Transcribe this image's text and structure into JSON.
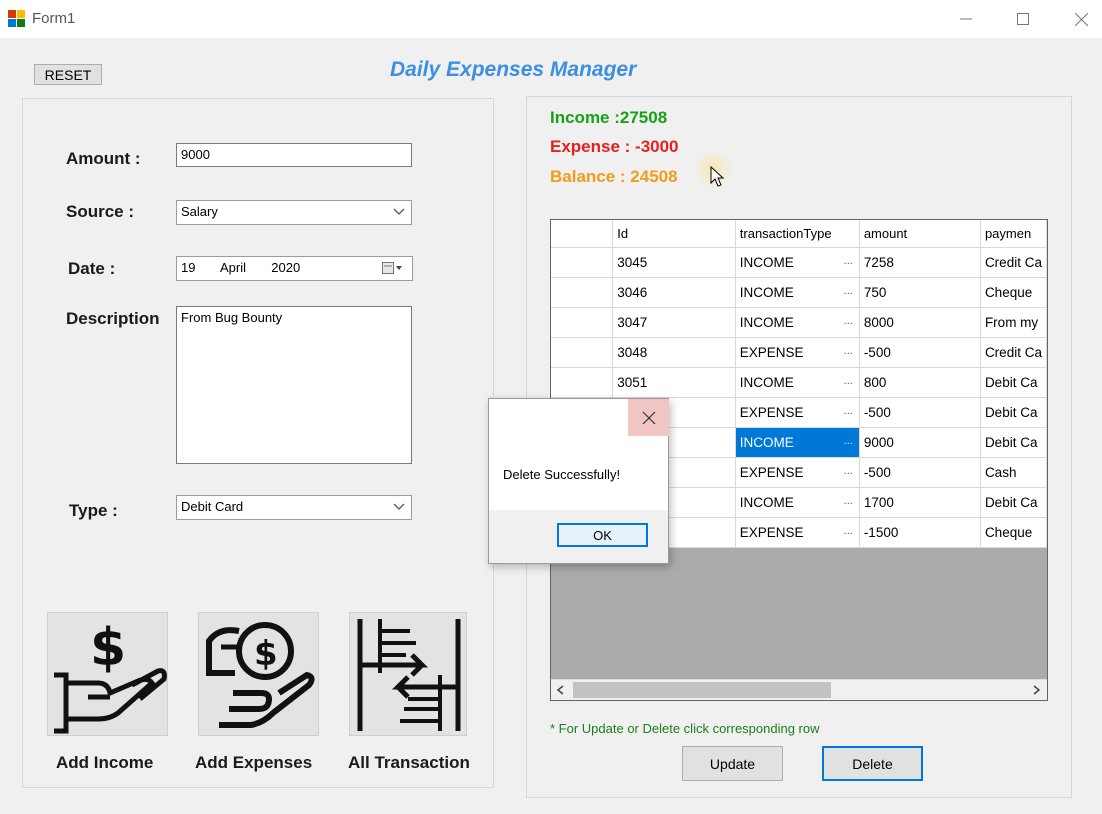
{
  "window": {
    "title": "Form1"
  },
  "toolbar": {
    "reset_label": "RESET"
  },
  "app_title": "Daily Expenses Manager",
  "form": {
    "amount_label": "Amount :",
    "amount_value": "9000",
    "source_label": "Source :",
    "source_value": "Salary",
    "date_label": "Date :",
    "date_day": "19",
    "date_month": "April",
    "date_year": "2020",
    "description_label": "Description",
    "description_value": "From Bug Bounty",
    "type_label": "Type :",
    "type_value": "Debit Card"
  },
  "actions": {
    "add_income": "Add Income",
    "add_expenses": "Add Expenses",
    "all_transaction": "All Transaction"
  },
  "summary": {
    "income": "Income :27508",
    "expense": "Expense : -3000",
    "balance": "Balance : 24508",
    "income_color": "#17a117",
    "expense_color": "#e81f1f",
    "balance_color": "#f29b1c"
  },
  "grid": {
    "columns": [
      "Id",
      "transactionType",
      "amount",
      "paymen"
    ],
    "rows": [
      {
        "id": "3045",
        "type": "INCOME",
        "amount": "7258",
        "payment": "Credit Ca"
      },
      {
        "id": "3046",
        "type": "INCOME",
        "amount": "750",
        "payment": "Cheque"
      },
      {
        "id": "3047",
        "type": "INCOME",
        "amount": "8000",
        "payment": "From my"
      },
      {
        "id": "3048",
        "type": "EXPENSE",
        "amount": "-500",
        "payment": "Credit Ca"
      },
      {
        "id": "3051",
        "type": "INCOME",
        "amount": "800",
        "payment": "Debit Ca"
      },
      {
        "id": "",
        "type": "EXPENSE",
        "amount": "-500",
        "payment": "Debit Ca"
      },
      {
        "id": "",
        "type": "INCOME",
        "amount": "9000",
        "payment": "Debit Ca"
      },
      {
        "id": "",
        "type": "EXPENSE",
        "amount": "-500",
        "payment": "Cash"
      },
      {
        "id": "",
        "type": "INCOME",
        "amount": "1700",
        "payment": "Debit Ca"
      },
      {
        "id": "",
        "type": "EXPENSE",
        "amount": "-1500",
        "payment": "Cheque"
      }
    ],
    "ellipsis": "..."
  },
  "hint": "* For Update or Delete click corresponding row",
  "buttons": {
    "update": "Update",
    "delete": "Delete"
  },
  "dialog": {
    "message": "Delete Successfully!",
    "ok": "OK"
  }
}
